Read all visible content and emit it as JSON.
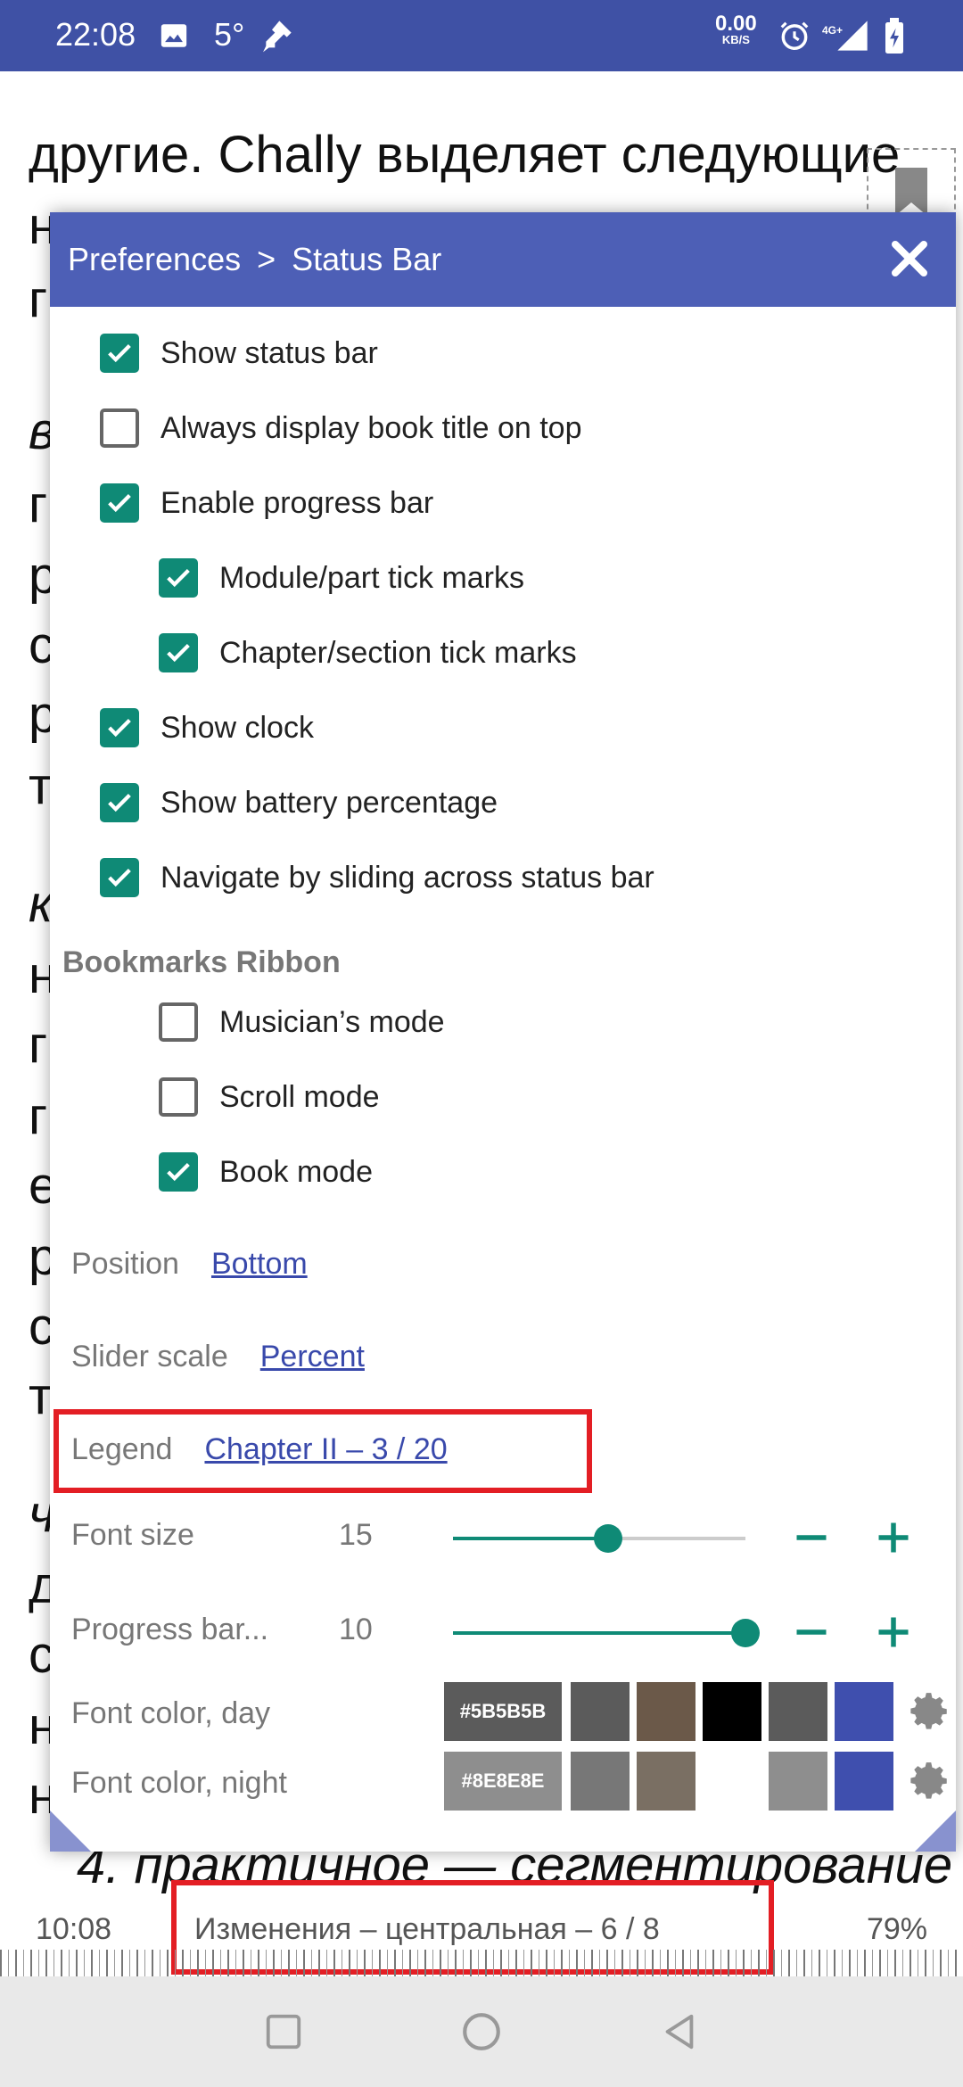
{
  "system_bar": {
    "time": "22:08",
    "temperature": "5°",
    "net_speed": "0.00",
    "net_unit": "KB/S",
    "network_type": "4G+",
    "icons": [
      "image-icon",
      "flashlight-icon",
      "alarm-icon",
      "signal-icon",
      "battery-charging-icon"
    ]
  },
  "book_text": {
    "first_line": "другие. Chally выделяет следующие",
    "left_fragments": [
      "н",
      "г",
      "в",
      "г",
      "р",
      "с",
      "р",
      "т",
      "к",
      "н",
      "г",
      "г",
      "е",
      "р",
      "с",
      "т",
      "ч",
      "д",
      "с",
      "н",
      "н"
    ],
    "bottom_line": "4. практичное — сегментирование"
  },
  "dialog": {
    "breadcrumb_root": "Preferences",
    "breadcrumb_separator": ">",
    "breadcrumb_current": "Status Bar",
    "options": [
      {
        "label": "Show status bar",
        "checked": true
      },
      {
        "label": "Always display book title on top",
        "checked": false
      },
      {
        "label": "Enable progress bar",
        "checked": true
      },
      {
        "label": "Module/part tick marks",
        "checked": true
      },
      {
        "label": "Chapter/section tick marks",
        "checked": true
      },
      {
        "label": "Show clock",
        "checked": true
      },
      {
        "label": "Show battery percentage",
        "checked": true
      },
      {
        "label": "Navigate by sliding across status bar",
        "checked": true
      }
    ],
    "bookmarks_title": "Bookmarks Ribbon",
    "bookmark_options": [
      {
        "label": "Musician’s mode",
        "checked": false
      },
      {
        "label": "Scroll mode",
        "checked": false
      },
      {
        "label": "Book mode",
        "checked": true
      }
    ],
    "position_label": "Position",
    "position_value": "Bottom",
    "slider_scale_label": "Slider scale",
    "slider_scale_value": "Percent",
    "legend_label": "Legend",
    "legend_value": "Chapter II – 3 / 20",
    "font_size_label": "Font size",
    "font_size_value": "15",
    "font_size_fraction": 0.53,
    "progress_bar_label": "Progress bar...",
    "progress_bar_value": "10",
    "progress_bar_fraction": 1.0,
    "font_color_day_label": "Font color, day",
    "font_color_day_hex": "#5B5B5B",
    "font_color_day_swatches": [
      "#5b5b5b",
      "#6b5949",
      "#000000",
      "#5b5b5b",
      "#3f4fae"
    ],
    "font_color_night_label": "Font color, night",
    "font_color_night_hex": "#8E8E8E",
    "font_color_night_swatches": [
      "#777777",
      "#7a6f63",
      "#ffffff",
      "#8e8e8e",
      "#3f4fae"
    ]
  },
  "reader_status": {
    "clock": "10:08",
    "legend": "Изменения – центральная – 6 / 8",
    "battery": "79%"
  },
  "colors": {
    "accent": "#0f8a76",
    "header": "#4d5fb6",
    "system_bar": "#3f51a5",
    "highlight": "#e31e24",
    "link": "#3949ab"
  }
}
